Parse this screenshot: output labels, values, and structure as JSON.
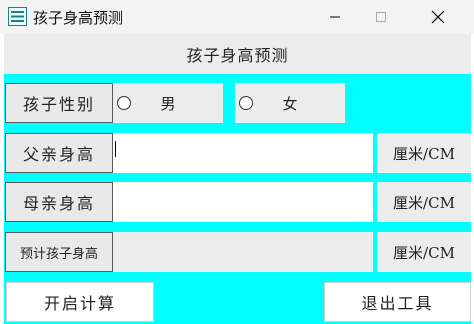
{
  "window": {
    "title": "孩子身高预测"
  },
  "header": {
    "title": "孩子身高预测"
  },
  "gender": {
    "label": "孩子性别",
    "options": [
      "男",
      "女"
    ]
  },
  "father": {
    "label": "父亲身高",
    "value": "",
    "unit": "厘米/CM"
  },
  "mother": {
    "label": "母亲身高",
    "value": "",
    "unit": "厘米/CM"
  },
  "prediction": {
    "label": "预计孩子身高",
    "value": "",
    "unit": "厘米/CM"
  },
  "actions": {
    "start_label": "开启计算",
    "exit_label": "退出工具"
  },
  "colors": {
    "background": "#00ffff",
    "panel": "#ececec"
  }
}
